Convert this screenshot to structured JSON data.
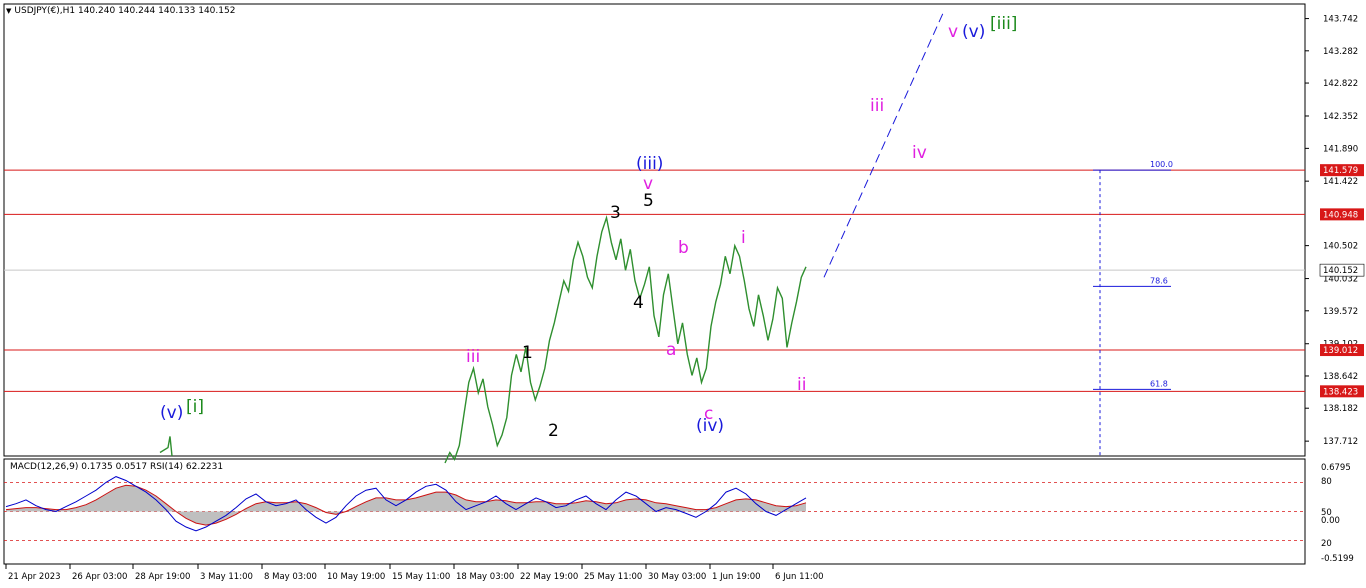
{
  "header": {
    "symbol": "USDJPY(€),H1",
    "ohlc": "140.240 140.244 140.133 140.152"
  },
  "indicator_header": {
    "macd": "MACD(12,26,9) 0.1735 0.0517",
    "rsi": "RSI(14) 62.2231"
  },
  "colors": {
    "price_line": "#2f8f2f",
    "level_line": "#d81818",
    "rsi_line": "#0000cc",
    "signal_line": "#cc1111",
    "histogram": "#b8b8b8",
    "wave_magenta": "#e020e0",
    "wave_blue": "#1a1adb",
    "wave_green": "#1c8a1c",
    "wave_black": "#000000",
    "projection": "#1a1adb",
    "current_price_tag_bg": "#ffffff",
    "level_tag_bg": "#d81818"
  },
  "chart_data": [
    {
      "type": "line",
      "panel": "price",
      "ylim": [
        137.5,
        143.95
      ],
      "grid": false,
      "price_labels": [
        "143.742",
        "143.282",
        "142.822",
        "142.352",
        "141.890",
        "141.422",
        "140.502",
        "140.032",
        "139.572",
        "139.102",
        "138.642",
        "138.182",
        "137.712"
      ],
      "levels": [
        {
          "value": 141.579,
          "label": "141.579"
        },
        {
          "value": 140.948,
          "label": "140.948"
        },
        {
          "value": 139.012,
          "label": "139.012"
        },
        {
          "value": 138.423,
          "label": "138.423"
        }
      ],
      "current_price": {
        "value": 140.152,
        "label": "140.152"
      },
      "fib_levels": [
        {
          "label": "100.0",
          "value": 141.579
        },
        {
          "label": "78.6",
          "value": 139.92
        },
        {
          "label": "61.8",
          "value": 138.45
        }
      ],
      "x_labels": [
        "21 Apr 2023",
        "26 Apr 03:00",
        "28 Apr 19:00",
        "3 May 11:00",
        "8 May 03:00",
        "10 May 19:00",
        "15 May 11:00",
        "18 May 03:00",
        "22 May 19:00",
        "25 May 11:00",
        "30 May 03:00",
        "1 Jun 19:00",
        "6 Jun 11:00"
      ],
      "series": [
        {
          "values": [
            137.4,
            137.55,
            137.45,
            137.65,
            138.1,
            138.55,
            138.75,
            138.4,
            138.6,
            138.2,
            137.95,
            137.65,
            137.8,
            138.05,
            138.65,
            138.95,
            138.7,
            139.05,
            138.55,
            138.3,
            138.5,
            138.75,
            139.15,
            139.4,
            139.7,
            140.0,
            139.85,
            140.3,
            140.55,
            140.35,
            140.05,
            139.9,
            140.35,
            140.7,
            140.9,
            140.55,
            140.3,
            140.6,
            140.15,
            140.45,
            140.0,
            139.75,
            139.95,
            140.2,
            139.5,
            139.2,
            139.8,
            140.1,
            139.6,
            139.1,
            139.4,
            138.95,
            138.65,
            138.9,
            138.55,
            138.75,
            139.35,
            139.7,
            139.95,
            140.35,
            140.1,
            140.5,
            140.35,
            140.0,
            139.6,
            139.35,
            139.8,
            139.5,
            139.15,
            139.45,
            139.9,
            139.75,
            139.05,
            139.4,
            139.7,
            140.05,
            140.2
          ]
        }
      ],
      "projection": [
        140.05,
        143.85
      ]
    },
    {
      "type": "line",
      "panel": "indicator",
      "ylim": [
        -0.5,
        0.9
      ],
      "scale_labels": [
        "0.6795",
        "80",
        "50",
        "0.00",
        "20",
        "-0.5199"
      ],
      "rsi_levels": [
        80,
        50,
        20
      ],
      "series": [
        {
          "name": "RSI(14)",
          "values": [
            55,
            58,
            62,
            56,
            52,
            50,
            55,
            60,
            66,
            72,
            80,
            86,
            82,
            76,
            70,
            62,
            52,
            40,
            34,
            30,
            34,
            40,
            46,
            54,
            63,
            68,
            60,
            56,
            58,
            62,
            52,
            44,
            38,
            44,
            56,
            66,
            72,
            74,
            62,
            56,
            62,
            70,
            76,
            78,
            72,
            60,
            52,
            56,
            60,
            66,
            58,
            52,
            58,
            64,
            60,
            54,
            56,
            62,
            66,
            58,
            52,
            62,
            70,
            66,
            58,
            50,
            54,
            52,
            48,
            44,
            50,
            58,
            70,
            74,
            68,
            58,
            50,
            46,
            52,
            58,
            64
          ]
        },
        {
          "name": "MACD(12,26,9) signal",
          "values": [
            52,
            53,
            54,
            54,
            53,
            52,
            52,
            54,
            57,
            62,
            68,
            74,
            77,
            76,
            72,
            66,
            58,
            50,
            43,
            38,
            36,
            38,
            42,
            47,
            53,
            58,
            60,
            59,
            59,
            60,
            58,
            54,
            49,
            47,
            50,
            55,
            60,
            64,
            64,
            62,
            62,
            64,
            67,
            70,
            70,
            67,
            62,
            60,
            60,
            62,
            61,
            59,
            59,
            60,
            60,
            58,
            58,
            59,
            61,
            60,
            58,
            59,
            62,
            63,
            62,
            59,
            58,
            56,
            54,
            52,
            52,
            54,
            58,
            62,
            63,
            62,
            59,
            56,
            55,
            56,
            59
          ]
        }
      ]
    }
  ],
  "annotations": {
    "wave_i_green_label": "[i]",
    "wave_v_blue_left": "(v)",
    "wave_iii_magenta_left": "iii",
    "wave_1": "1",
    "wave_2": "2",
    "wave_3": "3",
    "wave_4": "4",
    "wave_5": "5",
    "wave_v_magenta_top": "v",
    "wave_iii_blue": "(iii)",
    "wave_a": "a",
    "wave_b": "b",
    "wave_c": "c",
    "wave_iv_blue": "(iv)",
    "wave_i_magenta": "i",
    "wave_ii_magenta": "ii",
    "wave_iii_magenta_proj": "iii",
    "wave_iv_magenta_proj": "iv",
    "wave_v_magenta_proj": "v",
    "wave_v_blue_proj": "(v)",
    "wave_iii_green_proj": "[iii]"
  }
}
